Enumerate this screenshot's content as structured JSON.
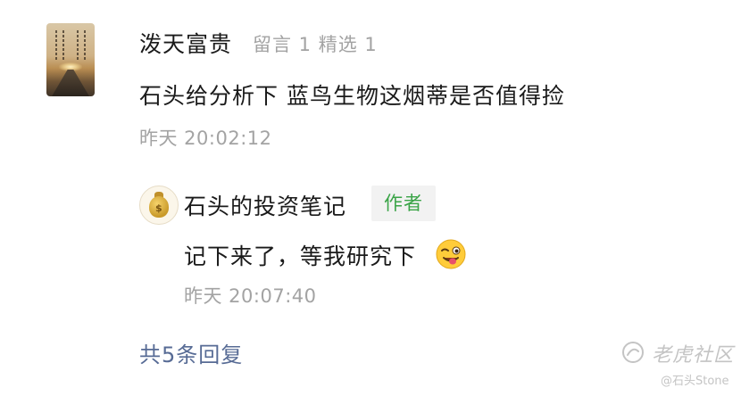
{
  "comment": {
    "username": "泼天富贵",
    "stats": "留言 1 精选 1",
    "text": "石头给分析下 蓝鸟生物这烟蒂是否值得捡",
    "time": "昨天 20:02:12",
    "avatar_icon": "sunset-road-avatar"
  },
  "reply": {
    "username": "石头的投资笔记",
    "badge": "作者",
    "text": "记下来了，等我研究下",
    "emoji": "winking-face-tongue-emoji",
    "time": "昨天 20:07:40",
    "avatar_icon": "money-bag-avatar"
  },
  "more_replies_label": "共5条回复",
  "watermark": {
    "brand": "老虎社区",
    "handle": "@石头Stone",
    "logo_icon": "tiger-community-logo"
  },
  "colors": {
    "text_primary": "#1a1a1a",
    "text_secondary": "#a3a3a3",
    "link": "#576b95",
    "author_badge": "#3aa447",
    "watermark": "#c4c4c4"
  }
}
